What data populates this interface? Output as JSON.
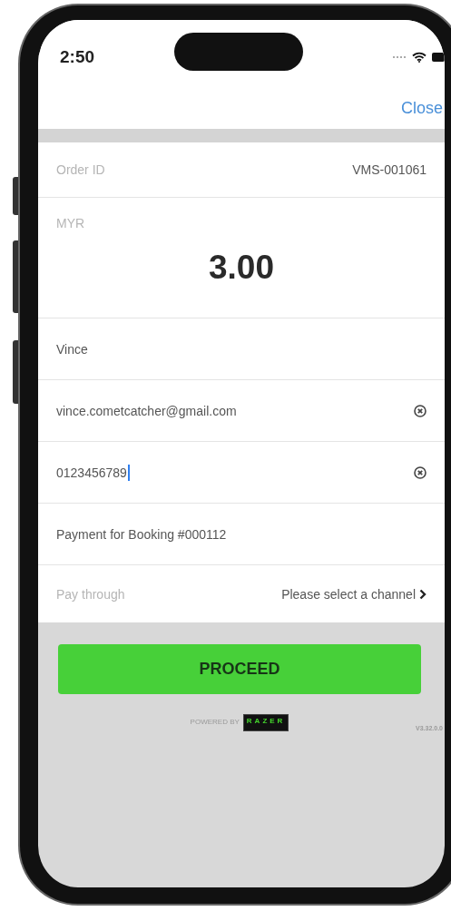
{
  "status_bar": {
    "time": "2:50"
  },
  "nav": {
    "close_label": "Close"
  },
  "order": {
    "label": "Order ID",
    "value": "VMS-001061"
  },
  "amount": {
    "currency": "MYR",
    "value": "3.00"
  },
  "fields": [
    {
      "value": "Vince",
      "clearable": false,
      "focused": false
    },
    {
      "value": "vince.cometcatcher@gmail.com",
      "clearable": true,
      "focused": false
    },
    {
      "value": "0123456789",
      "clearable": true,
      "focused": true
    },
    {
      "value": "Payment for Booking #000112",
      "clearable": false,
      "focused": false
    }
  ],
  "pay_through": {
    "label": "Pay through",
    "value": "Please select a channel"
  },
  "proceed_button": "PROCEED",
  "footer": {
    "powered_by": "POWERED BY",
    "logo_text": "RAZER",
    "version": "V3.32.0.0"
  }
}
